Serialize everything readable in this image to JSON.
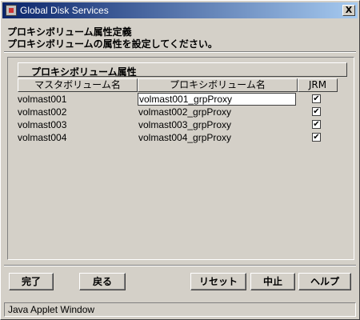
{
  "window": {
    "title": "Global Disk Services",
    "close_glyph": "X"
  },
  "header": {
    "title": "プロキシボリューム属性定義",
    "description": "プロキシボリュームの属性を設定してください。"
  },
  "section": {
    "title": "プロキシボリューム属性"
  },
  "table": {
    "columns": [
      "マスタボリューム名",
      "プロキシボリューム名",
      "JRM"
    ],
    "rows": [
      {
        "master": "volmast001",
        "proxy": "volmast001_grpProxy",
        "jrm": true
      },
      {
        "master": "volmast002",
        "proxy": "volmast002_grpProxy",
        "jrm": true
      },
      {
        "master": "volmast003",
        "proxy": "volmast003_grpProxy",
        "jrm": true
      },
      {
        "master": "volmast004",
        "proxy": "volmast004_grpProxy",
        "jrm": true
      }
    ],
    "check_glyph": "✔"
  },
  "buttons": {
    "finish": "完了",
    "back": "戻る",
    "reset": "リセット",
    "cancel": "中止",
    "help": "ヘルプ"
  },
  "status": {
    "text": "Java Applet Window"
  }
}
